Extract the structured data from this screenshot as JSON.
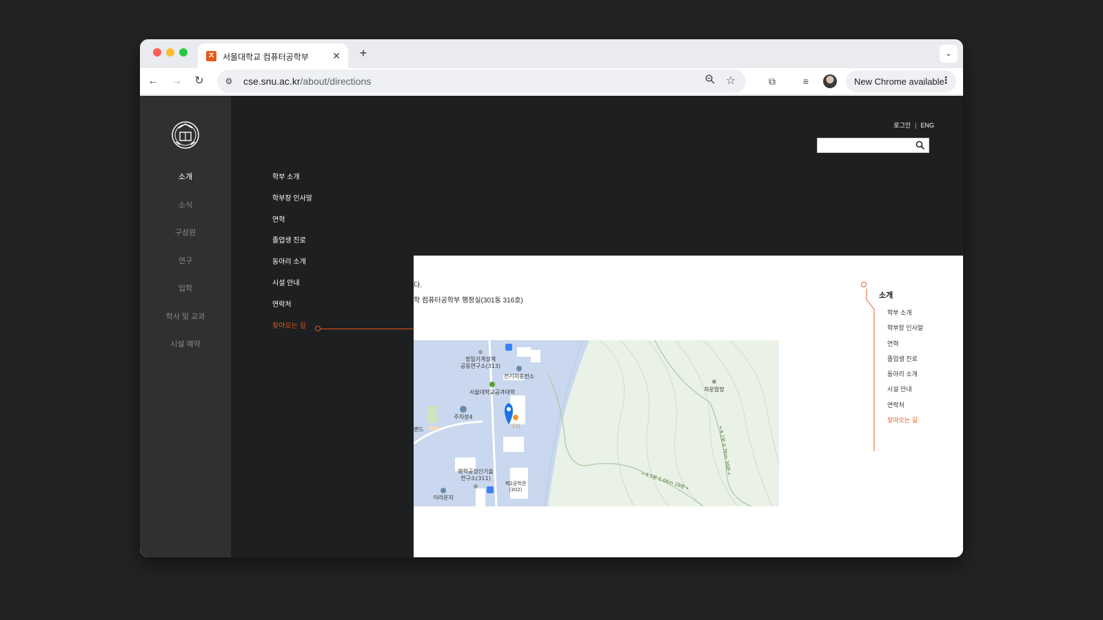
{
  "browser": {
    "tab_title": "서울대학교 컴퓨터공학부",
    "tab_favicon_letter": "ㅈ",
    "url_host": "cse.snu.ac.kr",
    "url_path": "/about/directions",
    "update_label": "New Chrome available"
  },
  "site": {
    "main_nav": [
      "소개",
      "소식",
      "구성원",
      "연구",
      "입학",
      "학사 및 교과",
      "시설 예약"
    ],
    "main_nav_active": "소개",
    "submenu": [
      "학부 소개",
      "학부장 인사말",
      "연혁",
      "졸업생 진로",
      "동아리 소개",
      "시설 안내",
      "연락처",
      "찾아오는 길"
    ],
    "submenu_active": "찾아오는 길",
    "util": {
      "login": "로그인",
      "separator": "|",
      "lang": "ENG"
    },
    "search_value": ""
  },
  "content": {
    "line1": "다.",
    "line2": "학 컴퓨터공학부 행정실(301동 316호)"
  },
  "map": {
    "labels": {
      "precision": "정밀기계설계",
      "precision2": "공동연구소(313)",
      "power": "전기차충전소",
      "eng": "서울대학교공과대학",
      "parking": "주차장4",
      "cu": "CU",
      "land": "랜드",
      "chem": "화학공정신기술",
      "chem2": "연구소(311)",
      "eng2": "제2공학관",
      "eng2num": "(302)",
      "irun": "이라운지",
      "jayun": "자운암장",
      "trail1": "←4.1분 0.6Km 29분→",
      "trail2": "←4.1분 0.7Km 30분→"
    }
  },
  "toc": {
    "title": "소개",
    "items": [
      "학부 소개",
      "학부장 인사말",
      "연혁",
      "졸업생 진로",
      "동아리 소개",
      "시설 안내",
      "연락처",
      "찾아오는 길"
    ],
    "active": "찾아오는 길"
  },
  "colors": {
    "accent": "#e8591c",
    "sidebar_bg": "#2f3032",
    "menu_bg": "#1e1f21",
    "map_water": "#c5d6ef",
    "map_park": "#eaf1e7",
    "map_blue_pin": "#1a73e8"
  }
}
